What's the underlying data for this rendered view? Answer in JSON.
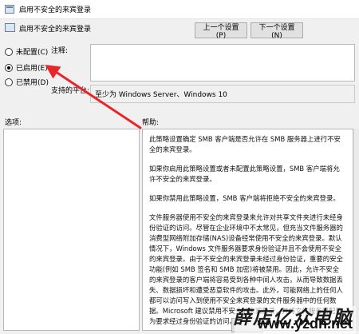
{
  "window": {
    "title": "启用不安全的来宾登录"
  },
  "header": {
    "policy_name": "启用不安全的来宾登录",
    "prev_button": "上一个设置(P)",
    "next_button": "下一个设置(N)"
  },
  "radios": [
    {
      "label": "未配置(C)",
      "checked": false
    },
    {
      "label": "已启用(E)",
      "checked": true
    },
    {
      "label": "已禁用(D)",
      "checked": false
    }
  ],
  "comment": {
    "label": "注释:",
    "value": ""
  },
  "supported": {
    "label": "支持的平台:",
    "value": "至少为 Windows Server、Windows 10"
  },
  "options": {
    "label": "选项:"
  },
  "help": {
    "label": "帮助:",
    "paragraphs": [
      "此策略设置确定 SMB 客户端是否允许在 SMB 服务器上进行不安全的来宾登录。",
      "如果你启用此策略设置或者未配置此策略设置，SMB 客户端将允许不安全的来宾登录。",
      "如果你禁用此策略设置，SMB 客户端将拒绝不安全的来宾登录。",
      "文件服务器使用不安全的来宾登录来允许对共享文件夹进行未经身份验证的访问。尽管在企业环境中不太常见，但充当文件服务器的消费型网络附加存储(NAS)设备经常使用不安全的来宾登录。默认情况下，Windows 文件服务器要求身份验证并且不会使用不安全的来宾登录。由于不安全的来宾登录未经过身份验证，重要的安全功能(例如 SMB 签名和 SMB 加密)将被禁用。因此，允许不安全的来宾登录的客户端将容易受到各种中间人攻击，从而导致数据丢失、数据损坏和遭受恶意软件的攻击。此外，可能网络上的任何人都可以访问写入到使用不安全来宾登录的文件服务器中的任何数据。Microsoft 建议禁用不安全的来宾登录，并将文件服务器配置为要求经过身份验证的访问。"
    ]
  },
  "watermark": {
    "text": "薛店亿众电脑",
    "url": "www.yzdn.net"
  },
  "colors": {
    "arrow": "#e8262a",
    "background": "#f0f0f0"
  }
}
